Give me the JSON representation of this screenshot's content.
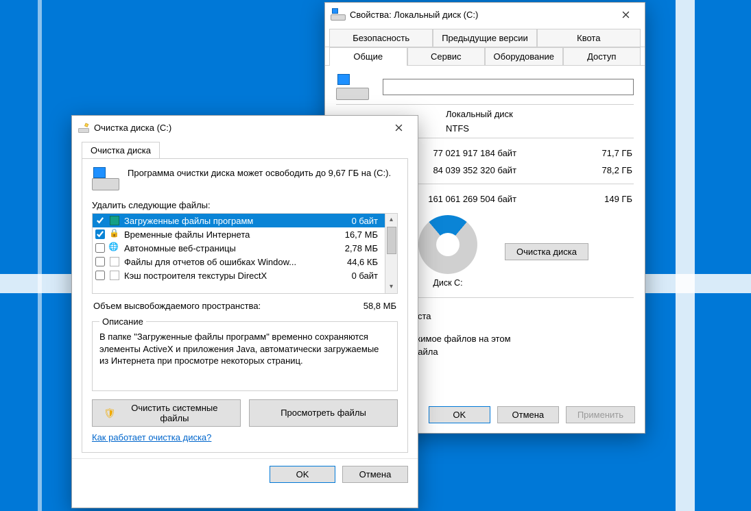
{
  "properties": {
    "title": "Свойства: Локальный диск (C:)",
    "tabs_top": [
      "Безопасность",
      "Предыдущие версии",
      "Квота"
    ],
    "tabs_bottom": [
      "Общие",
      "Сервис",
      "Оборудование",
      "Доступ"
    ],
    "active_tab": "Общие",
    "type_label": "Локальный диск",
    "fs_label": "NTFS",
    "rows": [
      {
        "bytes": "77 021 917 184 байт",
        "gb": "71,7 ГБ"
      },
      {
        "bytes": "84 039 352 320 байт",
        "gb": "78,2 ГБ"
      },
      {
        "bytes": "161 061 269 504 байт",
        "gb": "149 ГБ"
      }
    ],
    "disk_label": "Диск C:",
    "cleanup_btn": "Очистка диска",
    "footer_line1": "ск для экономии места",
    "footer_line2": "дексировать содержимое файлов на этом",
    "footer_line3": "ение к свойствам файла",
    "ok": "OK",
    "cancel": "Отмена",
    "apply": "Применить"
  },
  "cleanup": {
    "title": "Очистка диска  (C:)",
    "tab": "Очистка диска",
    "head_text": "Программа очистки диска может освободить до 9,67 ГБ на (C:).",
    "delete_label": "Удалить следующие файлы:",
    "files": [
      {
        "checked": true,
        "icon": "teal",
        "name": "Загруженные файлы программ",
        "size": "0 байт",
        "selected": true
      },
      {
        "checked": true,
        "icon": "lock",
        "name": "Временные файлы Интернета",
        "size": "16,7 МБ"
      },
      {
        "checked": false,
        "icon": "globe",
        "name": "Автономные веб-страницы",
        "size": "2,78 МБ"
      },
      {
        "checked": false,
        "icon": "page",
        "name": "Файлы для отчетов об ошибках Window...",
        "size": "44,6 КБ"
      },
      {
        "checked": false,
        "icon": "page",
        "name": "Кэш построителя текстуры DirectX",
        "size": "0 байт"
      }
    ],
    "freed_label": "Объем высвобождаемого пространства:",
    "freed_value": "58,8 МБ",
    "desc_legend": "Описание",
    "desc_text": "В папке \"Загруженные файлы программ\" временно сохраняются элементы ActiveX и приложения Java, автоматически загружаемые из Интернета при просмотре некоторых страниц.",
    "clean_sys_btn": "Очистить системные файлы",
    "view_files_btn": "Просмотреть файлы",
    "help_link": "Как работает очистка диска?",
    "ok": "OK",
    "cancel": "Отмена"
  }
}
